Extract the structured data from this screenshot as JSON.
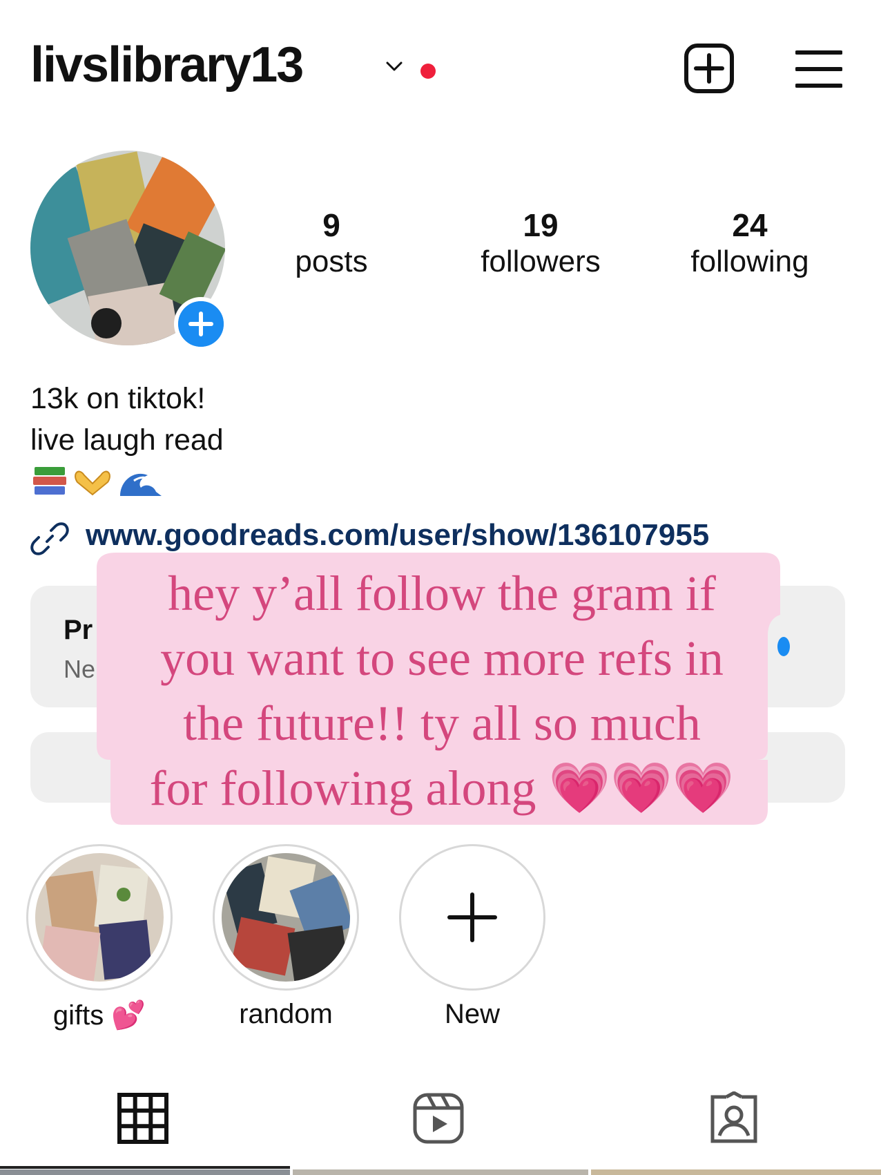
{
  "profile": {
    "username": "livslibrary13",
    "stats": [
      {
        "count": "9",
        "label": "posts"
      },
      {
        "count": "19",
        "label": "followers"
      },
      {
        "count": "24",
        "label": "following"
      }
    ],
    "bio": {
      "line1": "13k on tiktok!",
      "line2": "live laugh read",
      "emojis": [
        "books-emoji",
        "heart-hands-emoji",
        "wave-emoji"
      ],
      "link": "www.goodreads.com/user/show/136107955"
    }
  },
  "hidden_card": {
    "title_fragment": "Pr",
    "subtitle_fragment": "Ne"
  },
  "overlay": {
    "text_lines": [
      "hey y’all follow the gram if",
      "you want to see more refs in",
      "the future!! ty all so much",
      "for following along 💗💗💗"
    ],
    "bg_color": "#f9d3e5",
    "text_color": "#d4477d"
  },
  "highlights": [
    {
      "label": "gifts 💕"
    },
    {
      "label": "random"
    },
    {
      "label": "New"
    }
  ],
  "tabs": [
    "grid-icon",
    "reels-icon",
    "tagged-icon"
  ],
  "colors": {
    "notification_dot": "#ef1f3b",
    "accent_blue": "#1a8cf2",
    "link_text": "#0e2f5e"
  }
}
